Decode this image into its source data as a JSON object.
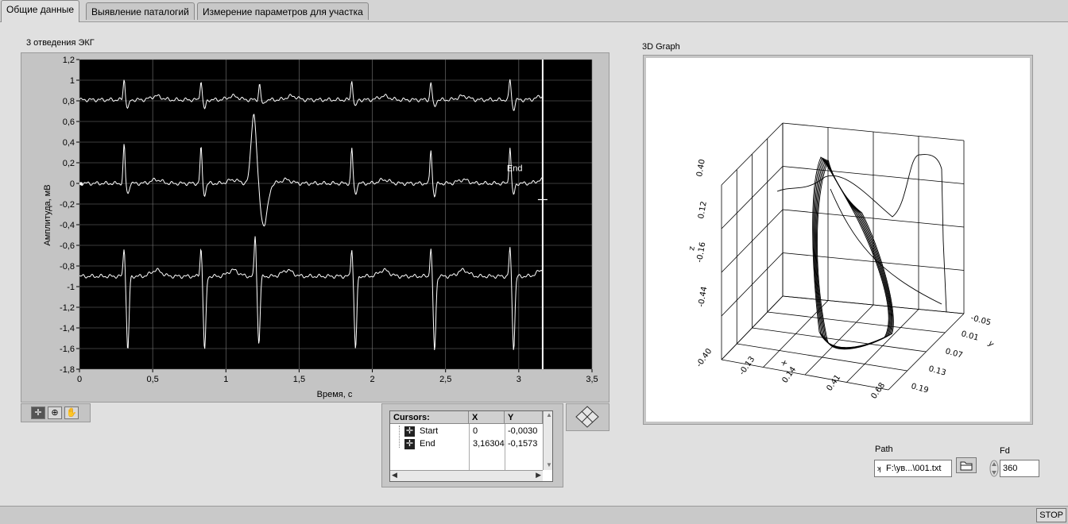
{
  "tabs": [
    "Общие данные",
    "Выявление паталогий",
    "Измерение параметров для участка"
  ],
  "ecg_graph": {
    "title": "3 отведения ЭКГ",
    "cursor_label": "End"
  },
  "legend": {
    "headers": [
      "Cursors:",
      "X",
      "Y"
    ],
    "rows": [
      {
        "name": "Start",
        "x": "0",
        "y": "-0,0030"
      },
      {
        "name": "End",
        "x": "3,16304",
        "y": "-0,1573"
      }
    ]
  },
  "graph3d": {
    "title": "3D Graph",
    "z_label": "z",
    "x_label": "x",
    "y_label": "y",
    "z_ticks": [
      "0.40",
      "0.12",
      "-0.16",
      "-0.44"
    ],
    "x_ticks": [
      "-0.40",
      "-0.13",
      "0.14",
      "0.41",
      "0.68"
    ],
    "y_ticks": [
      "-0.05",
      "0.01",
      "0.07",
      "0.13",
      "0.19"
    ]
  },
  "path": {
    "label": "Path",
    "value": "F:\\ув...\\001.txt"
  },
  "fd": {
    "label": "Fd",
    "value": "360"
  },
  "stop_label": "STOP",
  "colors": {
    "plot_bg": "#000000",
    "trace": "#ffffff",
    "panel": "#e0e0e0"
  },
  "chart_data": {
    "type": "line",
    "xlabel": "Время, с",
    "ylabel": "Амплитуда, мВ",
    "xlim": [
      0,
      3.5
    ],
    "ylim": [
      -1.8,
      1.2
    ],
    "x_ticks": [
      "0",
      "0,5",
      "1",
      "1,5",
      "2",
      "2,5",
      "3",
      "3,5"
    ],
    "y_ticks": [
      "1,2",
      "1",
      "0,8",
      "0,6",
      "0,4",
      "0,2",
      "0",
      "-0,2",
      "-0,4",
      "-0,6",
      "-0,8",
      "-1",
      "-1,2",
      "-1,4",
      "-1,6",
      "-1,8"
    ],
    "grid": true,
    "cursors": [
      {
        "name": "Start",
        "x": 0,
        "y": -0.003
      },
      {
        "name": "End",
        "x": 3.16304,
        "y": -0.1573
      }
    ],
    "series": [
      {
        "baseline": 0.81,
        "beats": [
          {
            "t": 0.305,
            "peak": 1.01,
            "dip": 0.72
          },
          {
            "t": 0.83,
            "peak": 1.0,
            "dip": 0.72
          },
          {
            "t": 1.23,
            "peak": 0.96,
            "dip": 0.76
          },
          {
            "t": 1.86,
            "peak": 1.0,
            "dip": 0.74
          },
          {
            "t": 2.4,
            "peak": 0.98,
            "dip": 0.74
          },
          {
            "t": 2.94,
            "peak": 1.01,
            "dip": 0.72
          }
        ]
      },
      {
        "baseline": 0.0,
        "beats": [
          {
            "t": 0.305,
            "peak": 0.37,
            "dip": -0.1
          },
          {
            "t": 0.83,
            "peak": 0.35,
            "dip": -0.11
          },
          {
            "t": 1.19,
            "peak": 0.68,
            "dip": -0.41
          },
          {
            "t": 1.86,
            "peak": 0.34,
            "dip": -0.1
          },
          {
            "t": 2.4,
            "peak": 0.33,
            "dip": -0.12
          },
          {
            "t": 2.94,
            "peak": 0.36,
            "dip": -0.11
          }
        ]
      },
      {
        "baseline": -0.9,
        "beats": [
          {
            "t": 0.305,
            "peak": -0.62,
            "dip": -1.62
          },
          {
            "t": 0.83,
            "peak": -0.62,
            "dip": -1.62
          },
          {
            "t": 1.2,
            "peak": -0.5,
            "dip": -1.55
          },
          {
            "t": 1.86,
            "peak": -0.62,
            "dip": -1.6
          },
          {
            "t": 2.4,
            "peak": -0.62,
            "dip": -1.62
          },
          {
            "t": 2.94,
            "peak": -0.62,
            "dip": -1.6
          }
        ]
      }
    ]
  }
}
